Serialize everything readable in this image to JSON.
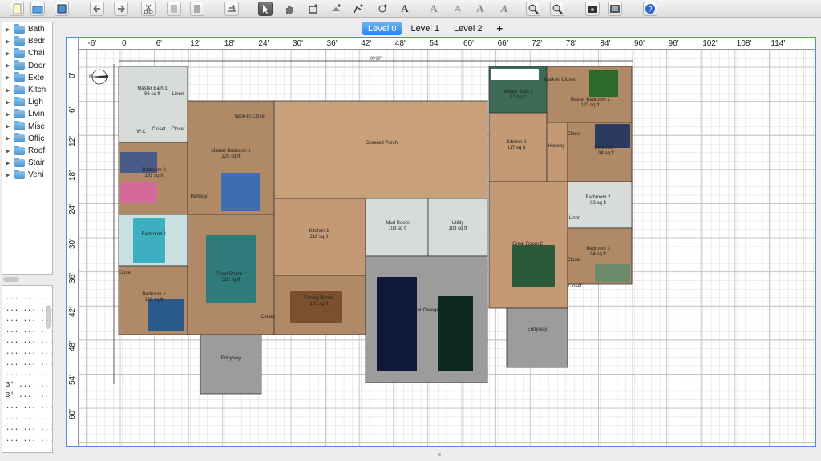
{
  "catalog": {
    "items": [
      "Bath",
      "Bedr",
      "Chai",
      "Door",
      "Exte",
      "Kitch",
      "Ligh",
      "Livin",
      "Misc",
      "Offic",
      "Roof",
      "Stair",
      "Vehi"
    ]
  },
  "furniture": {
    "rows": [
      "... ... ... .",
      "... ... ... .",
      "... ... ... .",
      "... ... ... .",
      "... ... ... .",
      "... ... ... .",
      "... ... ... .",
      "... ... ... .",
      "3' ... ... .",
      "3' ... ... .",
      "... ... ... .",
      "... ... ... .",
      "... ... ... .",
      "... ... ... ."
    ]
  },
  "levels": {
    "tabs": [
      "Level 0",
      "Level 1",
      "Level 2"
    ],
    "add": "+"
  },
  "ruler": {
    "top": [
      "-6'",
      "0'",
      "6'",
      "12'",
      "18'",
      "24'",
      "30'",
      "36'",
      "42'",
      "48'",
      "54'",
      "60'",
      "66'",
      "72'",
      "78'",
      "84'",
      "90'",
      "96'",
      "102'",
      "108'",
      "114'"
    ],
    "left": [
      "0'",
      "6'",
      "12'",
      "18'",
      "24'",
      "30'",
      "36'",
      "42'",
      "48'",
      "54'",
      "60'"
    ]
  },
  "rooms": [
    {
      "name": "Master Bath 1",
      "area": "96 sq ft"
    },
    {
      "name": "Linen",
      "area": ""
    },
    {
      "name": "W.C",
      "area": ""
    },
    {
      "name": "Closet",
      "area": ""
    },
    {
      "name": "Closet",
      "area": ""
    },
    {
      "name": "Walk-In Closet",
      "area": ""
    },
    {
      "name": "Master Bedroom 1",
      "area": "229 sq ft"
    },
    {
      "name": "Bedroom 2",
      "area": "151 sq ft"
    },
    {
      "name": "Hallway",
      "area": ""
    },
    {
      "name": "Bathroom 1",
      "area": ""
    },
    {
      "name": "Closet",
      "area": ""
    },
    {
      "name": "Bedroom 1",
      "area": "122 sq ft"
    },
    {
      "name": "Great Room 1",
      "area": "318 sq ft"
    },
    {
      "name": "Closet",
      "area": ""
    },
    {
      "name": "Entryway",
      "area": ""
    },
    {
      "name": "Covered Porch",
      "area": ""
    },
    {
      "name": "Kitchen 1",
      "area": "218 sq ft"
    },
    {
      "name": "Dining Room",
      "area": "123 sq ft"
    },
    {
      "name": "Mud Room",
      "area": "103 sq ft"
    },
    {
      "name": "Utility",
      "area": "103 sq ft"
    },
    {
      "name": "Car Garage",
      "area": ""
    },
    {
      "name": "Master Bath 2",
      "area": "97 sq ft"
    },
    {
      "name": "Walk-In Closet",
      "area": ""
    },
    {
      "name": "Master Bedroom 2",
      "area": "123 sq ft"
    },
    {
      "name": "Kitchen 2",
      "area": "117 sq ft"
    },
    {
      "name": "Closet",
      "area": ""
    },
    {
      "name": "Hallway",
      "area": ""
    },
    {
      "name": "Bedroom 4",
      "area": "94 sq ft"
    },
    {
      "name": "Bathroom 2",
      "area": "63 sq ft"
    },
    {
      "name": "Linen",
      "area": ""
    },
    {
      "name": "Great Room 2",
      "area": ""
    },
    {
      "name": "Bedroom 3",
      "area": "94 sq ft"
    },
    {
      "name": "Closet",
      "area": ""
    },
    {
      "name": "Closet",
      "area": ""
    },
    {
      "name": "Entryway",
      "area": ""
    }
  ],
  "dimension": "89'10\"",
  "compass": "N"
}
